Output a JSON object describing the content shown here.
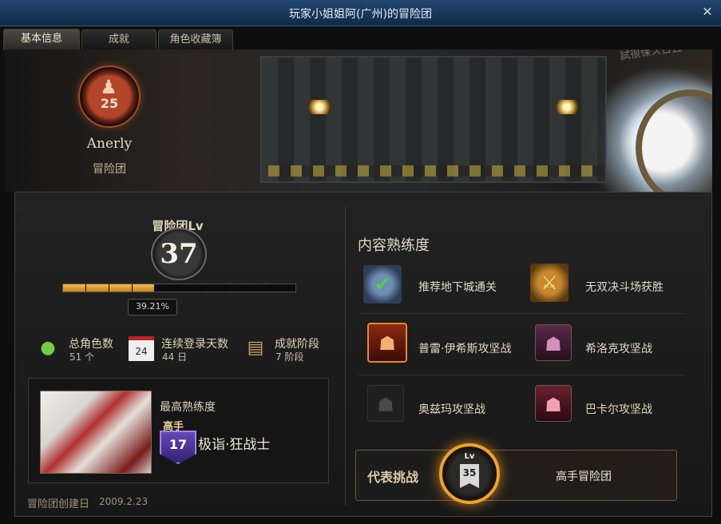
{
  "window": {
    "title": "玩家小姐姐阿(广州)的冒险团",
    "close_glyph": "✕"
  },
  "tabs": [
    {
      "label": "基本信息",
      "active": true
    },
    {
      "label": "成就",
      "active": false
    },
    {
      "label": "角色收藏簿",
      "active": false
    }
  ],
  "banner": {
    "tag_text": "試很保ス日且",
    "emblem_level": "25",
    "name": "Anerly",
    "club_label": "冒险团"
  },
  "level": {
    "label": "冒险团Lv",
    "value": "37",
    "progress_percent": 39.21,
    "progress_text": "39.21%"
  },
  "stats": [
    {
      "icon": "character-group-icon",
      "glyph": "👥",
      "label": "总角色数",
      "value": "51",
      "unit": "个"
    },
    {
      "icon": "calendar-icon",
      "glyph": "24",
      "label": "连续登录天数",
      "value": "44",
      "unit": "日"
    },
    {
      "icon": "scroll-icon",
      "glyph": "📜",
      "label": "成就阶段",
      "value": "7",
      "unit": "阶段"
    }
  ],
  "best": {
    "label": "最高熟练度",
    "rank_label": "高手",
    "rank_level": "17",
    "class_name": "极诣·狂战士"
  },
  "created": {
    "label": "冒险团创建日",
    "date": "2009.2.23"
  },
  "mastery": {
    "title": "内容熟练度",
    "items": [
      {
        "icon": "dungeon-check-icon",
        "label": "推荐地下城通关"
      },
      {
        "icon": "arena-shield-icon",
        "label": "无双决斗场获胜"
      },
      {
        "icon": "prey-isys-icon",
        "label": "普雷·伊希斯攻坚战"
      },
      {
        "icon": "hilder-icon",
        "label": "希洛克攻坚战"
      },
      {
        "icon": "ozma-icon",
        "label": "奥兹玛攻坚战"
      },
      {
        "icon": "bakal-icon",
        "label": "巴卡尔攻坚战"
      }
    ]
  },
  "representative": {
    "label": "代表挑战",
    "badge_prefix": "Lv",
    "badge_level": "35",
    "title": "高手冒险团"
  },
  "colors": {
    "accent": "#f2a12c",
    "progress": "#d99a2b",
    "title_bar": "#1a3a5e"
  }
}
